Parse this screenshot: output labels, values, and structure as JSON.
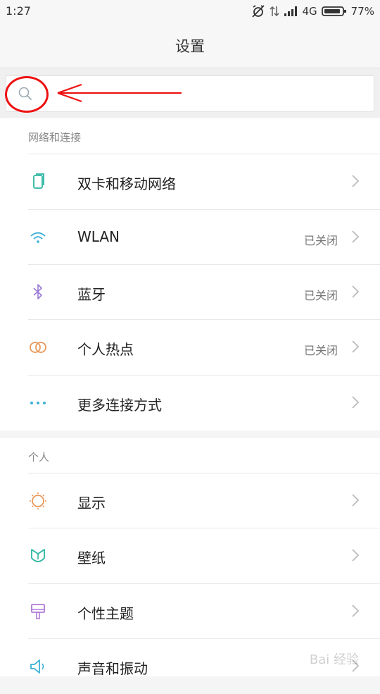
{
  "status_bar": {
    "time": "1:27",
    "network": "4G",
    "battery": "77%"
  },
  "header": {
    "title": "设置"
  },
  "search": {
    "placeholder": ""
  },
  "sections": [
    {
      "header": "网络和连接",
      "items": [
        {
          "label": "双卡和移动网络",
          "status": "",
          "icon": "sim-cards-icon"
        },
        {
          "label": "WLAN",
          "status": "已关闭",
          "icon": "wifi-icon"
        },
        {
          "label": "蓝牙",
          "status": "已关闭",
          "icon": "bluetooth-icon"
        },
        {
          "label": "个人热点",
          "status": "已关闭",
          "icon": "hotspot-icon"
        },
        {
          "label": "更多连接方式",
          "status": "",
          "icon": "more-dots-icon"
        }
      ]
    },
    {
      "header": "个人",
      "items": [
        {
          "label": "显示",
          "status": "",
          "icon": "display-sun-icon"
        },
        {
          "label": "壁纸",
          "status": "",
          "icon": "wallpaper-icon"
        },
        {
          "label": "个性主题",
          "status": "",
          "icon": "theme-brush-icon"
        },
        {
          "label": "声音和振动",
          "status": "",
          "icon": "speaker-icon"
        }
      ]
    }
  ],
  "watermark": "Bai 经验"
}
